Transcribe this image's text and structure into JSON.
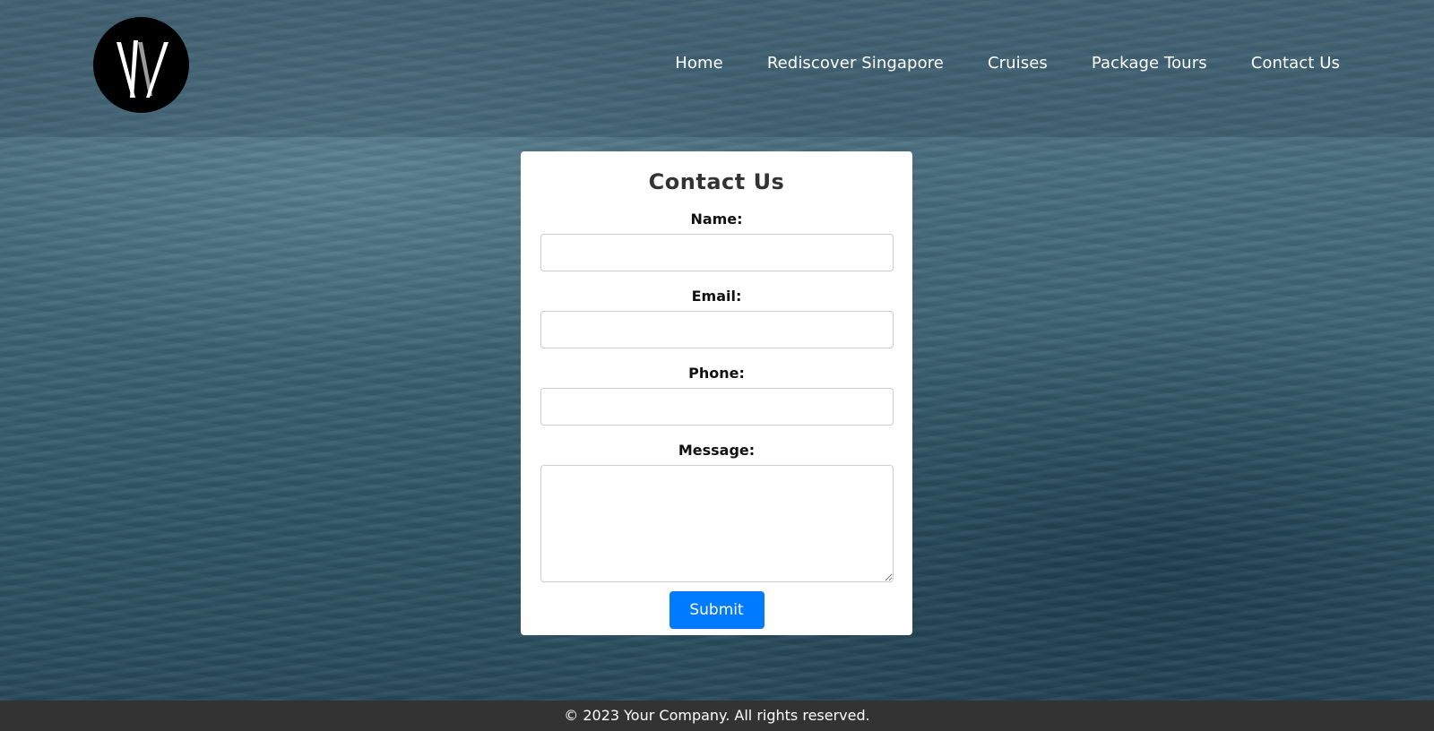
{
  "nav": {
    "items": [
      "Home",
      "Rediscover Singapore",
      "Cruises",
      "Package Tours",
      "Contact Us"
    ]
  },
  "logo": {
    "icon": "w-monogram-logo"
  },
  "form": {
    "title": "Contact Us",
    "name_label": "Name:",
    "email_label": "Email:",
    "phone_label": "Phone:",
    "message_label": "Message:",
    "name_value": "",
    "email_value": "",
    "phone_value": "",
    "message_value": "",
    "submit_label": "Submit"
  },
  "footer": {
    "text": "© 2023 Your Company. All rights reserved."
  },
  "colors": {
    "submit_bg": "#007bff",
    "footer_bg": "#333333",
    "card_bg": "#ffffff"
  }
}
